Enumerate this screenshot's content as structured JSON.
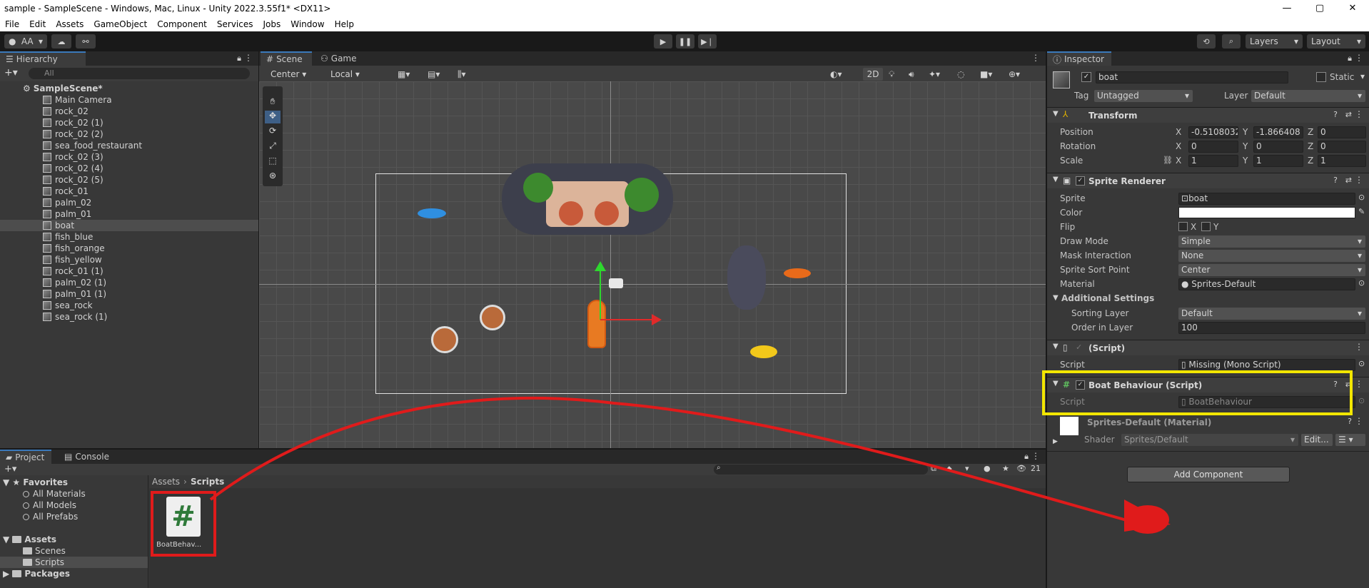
{
  "window": {
    "title": "sample - SampleScene - Windows, Mac, Linux - Unity 2022.3.55f1* <DX11>",
    "controls": [
      "—",
      "▢",
      "✕"
    ]
  },
  "menu": [
    "File",
    "Edit",
    "Assets",
    "GameObject",
    "Component",
    "Services",
    "Jobs",
    "Window",
    "Help"
  ],
  "toolbar": {
    "account": "AA",
    "layers": "Layers",
    "layout": "Layout"
  },
  "hierarchy": {
    "tab": "Hierarchy",
    "search_placeholder": "All",
    "scene": "SampleScene*",
    "items": [
      {
        "label": "Main Camera"
      },
      {
        "label": "rock_02"
      },
      {
        "label": "rock_02 (1)"
      },
      {
        "label": "rock_02 (2)"
      },
      {
        "label": "sea_food_restaurant"
      },
      {
        "label": "rock_02 (3)"
      },
      {
        "label": "rock_02 (4)"
      },
      {
        "label": "rock_02 (5)"
      },
      {
        "label": "rock_01"
      },
      {
        "label": "palm_02"
      },
      {
        "label": "palm_01"
      },
      {
        "label": "boat",
        "selected": true
      },
      {
        "label": "fish_blue"
      },
      {
        "label": "fish_orange"
      },
      {
        "label": "fish_yellow"
      },
      {
        "label": "rock_01 (1)"
      },
      {
        "label": "palm_02 (1)"
      },
      {
        "label": "palm_01 (1)"
      },
      {
        "label": "sea_rock"
      },
      {
        "label": "sea_rock (1)"
      }
    ]
  },
  "scene": {
    "tabs": [
      "Scene",
      "Game"
    ],
    "pivot": "Center",
    "space": "Local",
    "mode_2d": "2D"
  },
  "inspector": {
    "tab": "Inspector",
    "object_name": "boat",
    "static_label": "Static",
    "tag_label": "Tag",
    "tag_value": "Untagged",
    "layer_label": "Layer",
    "layer_value": "Default",
    "transform": {
      "title": "Transform",
      "position_label": "Position",
      "rotation_label": "Rotation",
      "scale_label": "Scale",
      "position": {
        "x": "-0.5108032",
        "y": "-1.866408",
        "z": "0"
      },
      "rotation": {
        "x": "0",
        "y": "0",
        "z": "0"
      },
      "scale": {
        "x": "1",
        "y": "1",
        "z": "1"
      },
      "x": "X",
      "y": "Y",
      "z": "Z"
    },
    "sprite_renderer": {
      "title": "Sprite Renderer",
      "sprite_label": "Sprite",
      "sprite_value": "boat",
      "color_label": "Color",
      "flip_label": "Flip",
      "flip_x": "X",
      "flip_y": "Y",
      "draw_mode_label": "Draw Mode",
      "draw_mode_value": "Simple",
      "mask_label": "Mask Interaction",
      "mask_value": "None",
      "sort_point_label": "Sprite Sort Point",
      "sort_point_value": "Center",
      "material_label": "Material",
      "material_value": "Sprites-Default",
      "additional_label": "Additional Settings",
      "sorting_layer_label": "Sorting Layer",
      "sorting_layer_value": "Default",
      "order_label": "Order in Layer",
      "order_value": "100"
    },
    "missing_script": {
      "title": "(Script)",
      "script_label": "Script",
      "script_value": "Missing (Mono Script)"
    },
    "boat_behaviour": {
      "title": "Boat Behaviour (Script)",
      "script_label": "Script",
      "script_value": "BoatBehaviour"
    },
    "material": {
      "title": "Sprites-Default (Material)",
      "shader_label": "Shader",
      "shader_value": "Sprites/Default",
      "edit_label": "Edit..."
    },
    "add_component": "Add Component"
  },
  "project": {
    "tabs": [
      "Project",
      "Console"
    ],
    "count": "21",
    "favorites_label": "Favorites",
    "favorites": [
      "All Materials",
      "All Models",
      "All Prefabs"
    ],
    "assets_label": "Assets",
    "asset_folders": [
      "Scenes",
      "Scripts"
    ],
    "packages_label": "Packages",
    "breadcrumb": [
      "Assets",
      "Scripts"
    ],
    "files": [
      {
        "name": "BoatBehav..."
      }
    ]
  },
  "colors": {
    "highlight_yellow": "#f2e600",
    "annotation_red": "#e01b1b",
    "accent_blue": "#3a79bb",
    "script_green": "#2f7a3a"
  }
}
